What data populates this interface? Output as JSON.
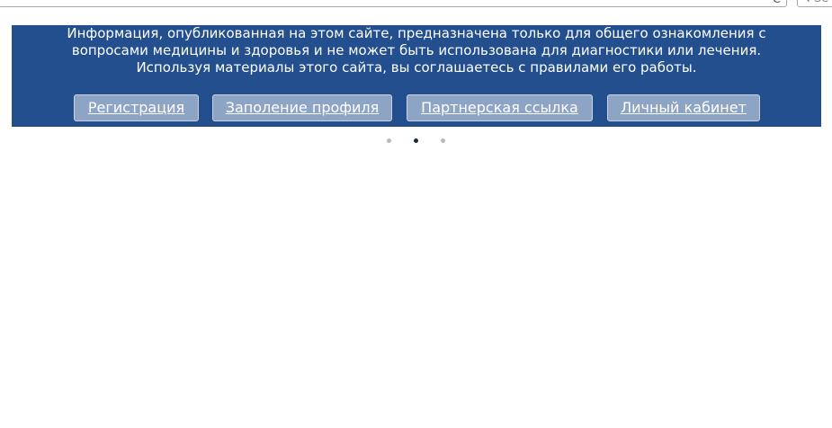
{
  "browser": {
    "search_placeholder": "Se"
  },
  "banner": {
    "disclaimer_lines": [
      "Информация, опубликованная на этом сайте, предназначена только для общего ознакомления с",
      "вопросами медицины и здоровья и не может быть использована для диагностики или лечения.",
      "Используя материалы этого сайта, вы соглашаетесь с правилами его работы."
    ],
    "buttons": [
      {
        "label": "Регистрация"
      },
      {
        "label": "Заполение профиля"
      },
      {
        "label": "Партнерская ссылка"
      },
      {
        "label": "Личный кабинет"
      }
    ],
    "background_color": "#234f8e",
    "button_color": "#8ea4c5"
  },
  "carousel": {
    "dot_count": 3,
    "active_index": 1
  }
}
